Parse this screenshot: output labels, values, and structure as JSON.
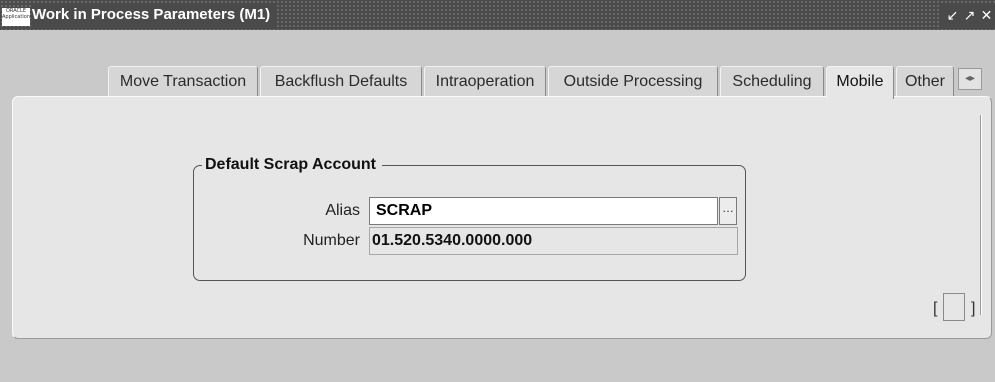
{
  "window": {
    "title": "Work in Process Parameters (M1)",
    "logo_text": "ORACLE Applications",
    "controls": [
      "↙",
      "↗",
      "✕"
    ]
  },
  "tabs": [
    {
      "label": "Move Transaction",
      "active": false
    },
    {
      "label": "Backflush Defaults",
      "active": false
    },
    {
      "label": "Intraoperation",
      "active": false
    },
    {
      "label": "Outside Processing",
      "active": false
    },
    {
      "label": "Scheduling",
      "active": false
    },
    {
      "label": "Mobile",
      "active": true
    },
    {
      "label": "Other",
      "active": false
    }
  ],
  "tab_scroll_glyph": "◂▸",
  "group": {
    "title": "Default Scrap Account",
    "alias_label": "Alias",
    "alias_value": "SCRAP",
    "lov_glyph": "…",
    "number_label": "Number",
    "number_value": "01.520.5340.0000.000"
  },
  "bracket": {
    "left": "[",
    "right": "]"
  }
}
